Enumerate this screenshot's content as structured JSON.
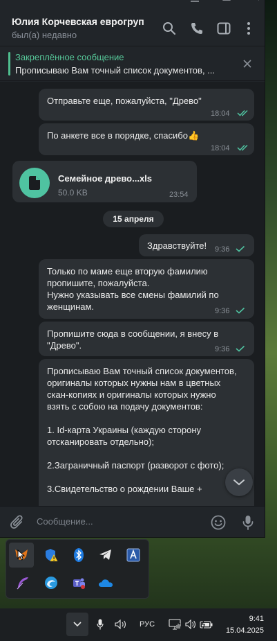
{
  "header": {
    "title": "Юлия Корчевская еврогруп",
    "status": "был(а) недавно",
    "icons": [
      "search-icon",
      "phone-icon",
      "sidebar-toggle-icon",
      "more-vertical-icon"
    ]
  },
  "pinned": {
    "title": "Закреплённое сообщение",
    "text": "Прописываю Вам точный список документов, ..."
  },
  "messages": [
    {
      "text": "Отправьте еще, пожалуйста, \"Древо\"",
      "time": "18:04",
      "status": "read"
    },
    {
      "text": "По анкете все в порядке, спасибо",
      "emoji": "👍",
      "time": "18:04",
      "status": "read"
    },
    {
      "file_name": "Семейное древо...xls",
      "file_size": "50.0 KB",
      "time": "23:54",
      "incoming": true
    },
    {
      "text": "Здравствуйте!",
      "time": "9:36",
      "status": "sent"
    },
    {
      "text": "Только по маме еще вторую фамилию\nпропишите, пожалуйста.\nНужно указывать все смены фамилий по\nженщинам.",
      "time": "9:36",
      "status": "sent"
    },
    {
      "text": "Пропишите сюда в сообщении, я внесу в\n\"Древо\".",
      "time": "9:36",
      "status": "sent"
    },
    {
      "text": "Прописываю Вам точный список документов,\nоригиналы которых нужны нам в цветных\nскан-копиях и оригиналы которых нужно\nвзять с собою на подачу документов:\n\n1. Id-карта Украины (каждую сторону\nотсканировать отдельно);\n\n2.Заграничный паспорт (разворот с фото);\n\n3.Свидетельство о рождении Ваше +"
    }
  ],
  "day_separator": "15 апреля",
  "composer": {
    "placeholder": "Сообщение..."
  },
  "taskbar": {
    "lang": "РУС",
    "time": "9:41",
    "date": "15.04.2025"
  },
  "tray_icons": [
    "metamask-fox-icon",
    "windows-security-warning-icon",
    "bluetooth-icon",
    "telegram-icon",
    "keyboard-layout-a-icon",
    "feather-icon",
    "browser-globe-icon",
    "teams-icon",
    "onedrive-cloud-icon"
  ],
  "colors": {
    "accent": "#4fc3a1",
    "bubble": "#2c3034",
    "background": "#1a1d20"
  }
}
